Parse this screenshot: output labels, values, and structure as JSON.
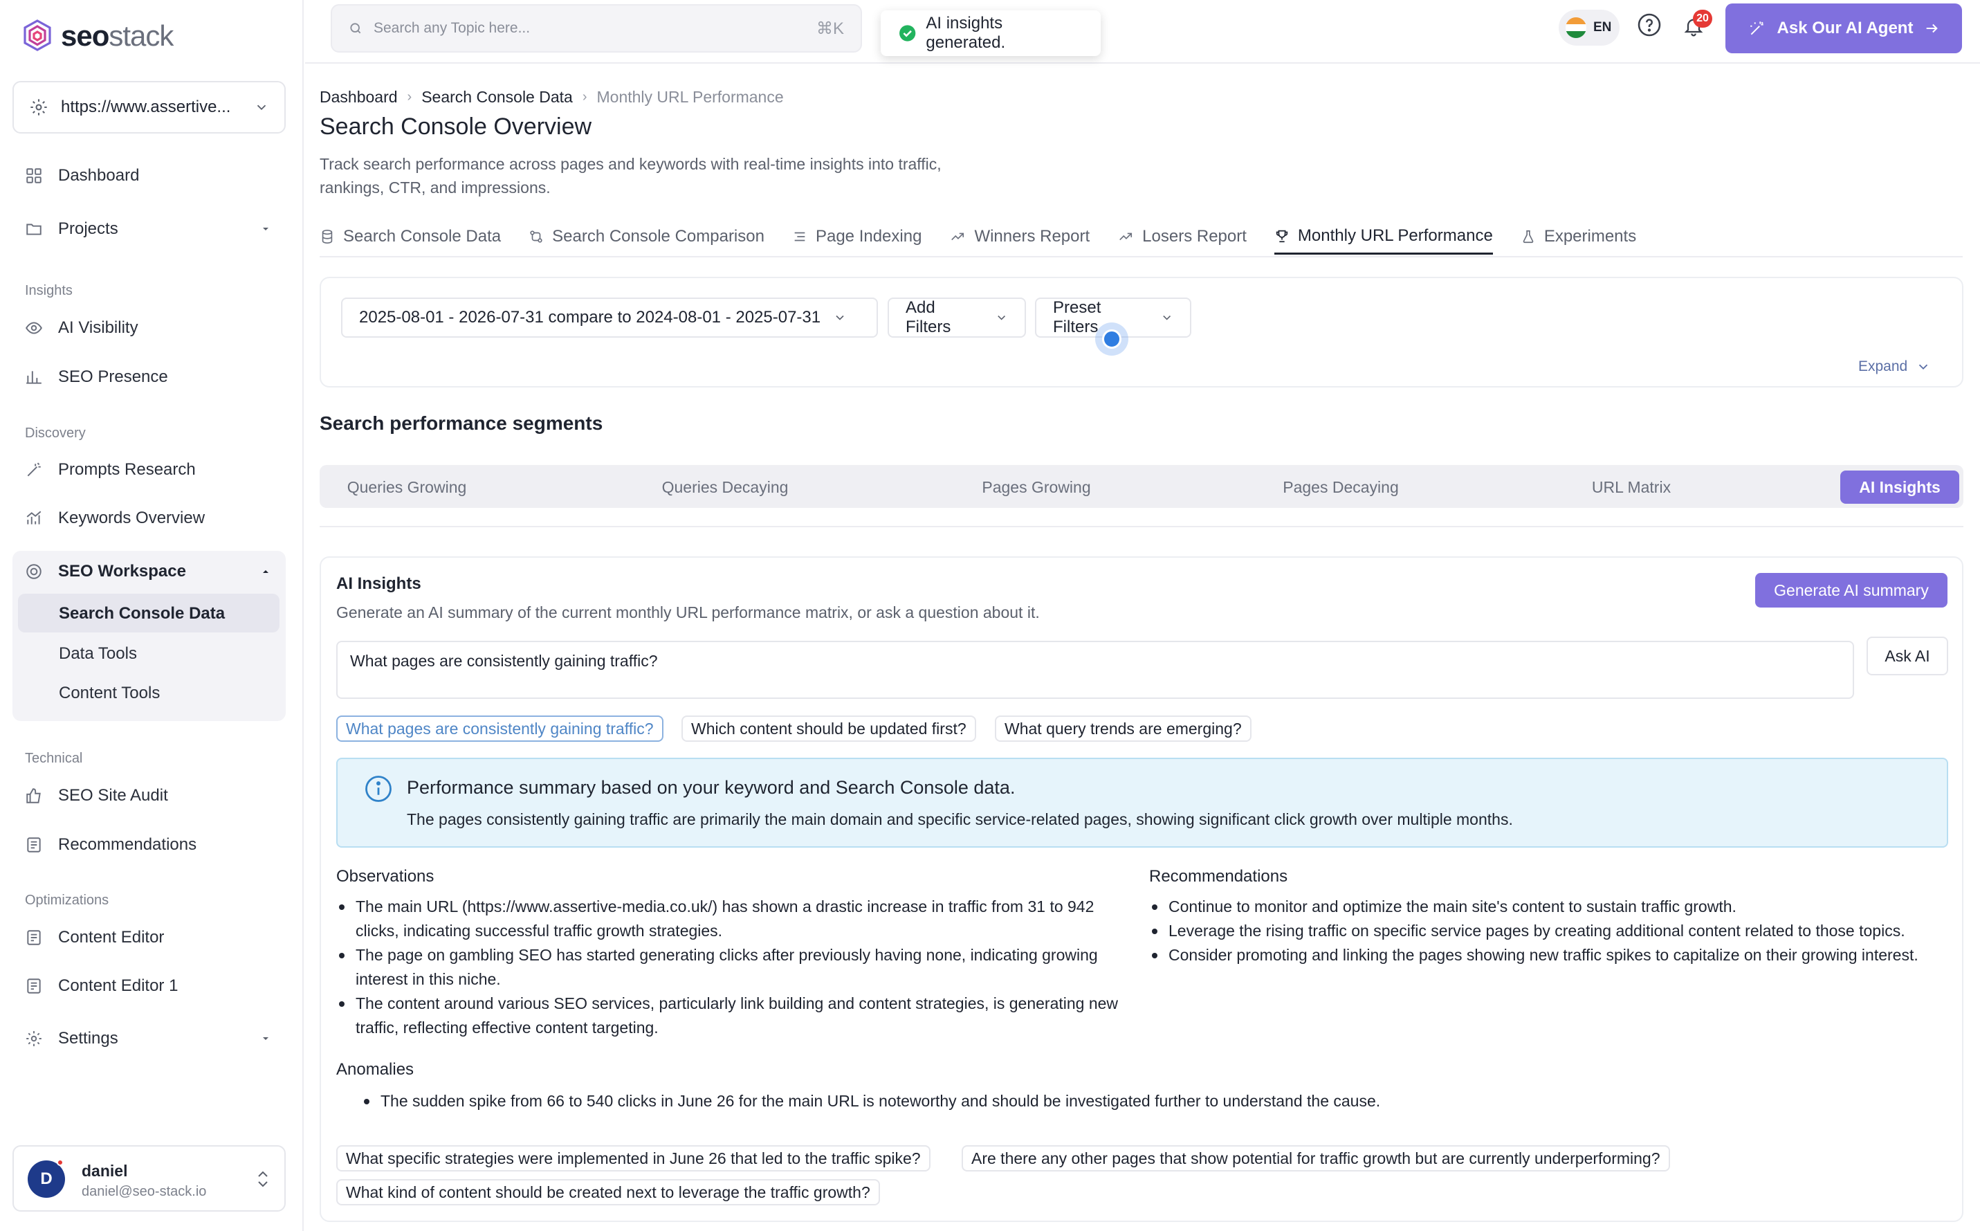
{
  "brand": {
    "name_bold": "seo",
    "name_light": "stack"
  },
  "site_selector": {
    "value": "https://www.assertive..."
  },
  "nav": {
    "dashboard": "Dashboard",
    "projects": "Projects",
    "insights_label": "Insights",
    "ai_visibility": "AI Visibility",
    "seo_presence": "SEO Presence",
    "discovery_label": "Discovery",
    "prompts_research": "Prompts Research",
    "keywords_overview": "Keywords Overview",
    "seo_workspace": "SEO Workspace",
    "search_console_data": "Search Console Data",
    "data_tools": "Data Tools",
    "content_tools": "Content Tools",
    "technical_label": "Technical",
    "seo_site_audit": "SEO Site Audit",
    "recommendations": "Recommendations",
    "optimizations_label": "Optimizations",
    "content_editor": "Content Editor",
    "content_editor_1": "Content Editor 1",
    "settings": "Settings"
  },
  "user": {
    "initial": "D",
    "name": "daniel",
    "email": "daniel@seo-stack.io"
  },
  "topbar": {
    "search_placeholder": "Search any Topic here...",
    "shortcut": "⌘K",
    "toast": "AI insights generated.",
    "lang": "EN",
    "notifications": "20",
    "agent_button": "Ask Our AI Agent"
  },
  "breadcrumb": {
    "a": "Dashboard",
    "b": "Search Console Data",
    "c": "Monthly URL Performance"
  },
  "page": {
    "title": "Search Console Overview",
    "description": "Track search performance across pages and keywords with real-time insights into traffic, rankings, CTR, and impressions."
  },
  "tabs": [
    "Search Console Data",
    "Search Console Comparison",
    "Page Indexing",
    "Winners Report",
    "Losers Report",
    "Monthly URL Performance",
    "Experiments"
  ],
  "filters": {
    "date_range": "2025-08-01 - 2026-07-31 compare to 2024-08-01 - 2025-07-31",
    "add_filters": "Add Filters",
    "preset_filters": "Preset Filters",
    "expand": "Expand"
  },
  "segments": {
    "title": "Search performance segments",
    "items": [
      "Queries Growing",
      "Queries Decaying",
      "Pages Growing",
      "Pages Decaying",
      "URL Matrix",
      "AI Insights"
    ]
  },
  "ai": {
    "title": "AI Insights",
    "subtitle": "Generate an AI summary of the current monthly URL performance matrix, or ask a question about it.",
    "generate_button": "Generate AI summary",
    "question": "What pages are consistently gaining traffic?",
    "ask_button": "Ask AI",
    "suggestions": [
      "What pages are consistently gaining traffic?",
      "Which content should be updated first?",
      "What query trends are emerging?"
    ],
    "summary_title": "Performance summary based on your keyword and Search Console data.",
    "summary_text": "The pages consistently gaining traffic are primarily the main domain and specific service-related pages, showing significant click growth over multiple months.",
    "observations_title": "Observations",
    "observations": [
      "The main URL (https://www.assertive-media.co.uk/) has shown a drastic increase in traffic from 31 to 942 clicks, indicating successful traffic growth strategies.",
      "The page on gambling SEO has started generating clicks after previously having none, indicating growing interest in this niche.",
      "The content around various SEO services, particularly link building and content strategies, is generating new traffic, reflecting effective content targeting."
    ],
    "recommendations_title": "Recommendations",
    "recommendations": [
      "Continue to monitor and optimize the main site's content to sustain traffic growth.",
      "Leverage the rising traffic on specific service pages by creating additional content related to those topics.",
      "Consider promoting and linking the pages showing new traffic spikes to capitalize on their growing interest."
    ],
    "anomalies_title": "Anomalies",
    "anomalies": [
      "The sudden spike from 66 to 540 clicks in June 26 for the main URL is noteworthy and should be investigated further to understand the cause."
    ],
    "followups": [
      "What specific strategies were implemented in June 26 that led to the traffic spike?",
      "Are there any other pages that show potential for traffic growth but are currently underperforming?",
      "What kind of content should be created next to leverage the traffic growth?"
    ]
  },
  "colors": {
    "accent": "#8070de",
    "info_bg": "#e6f4fb",
    "success": "#22b35e",
    "badge": "#e53935"
  }
}
